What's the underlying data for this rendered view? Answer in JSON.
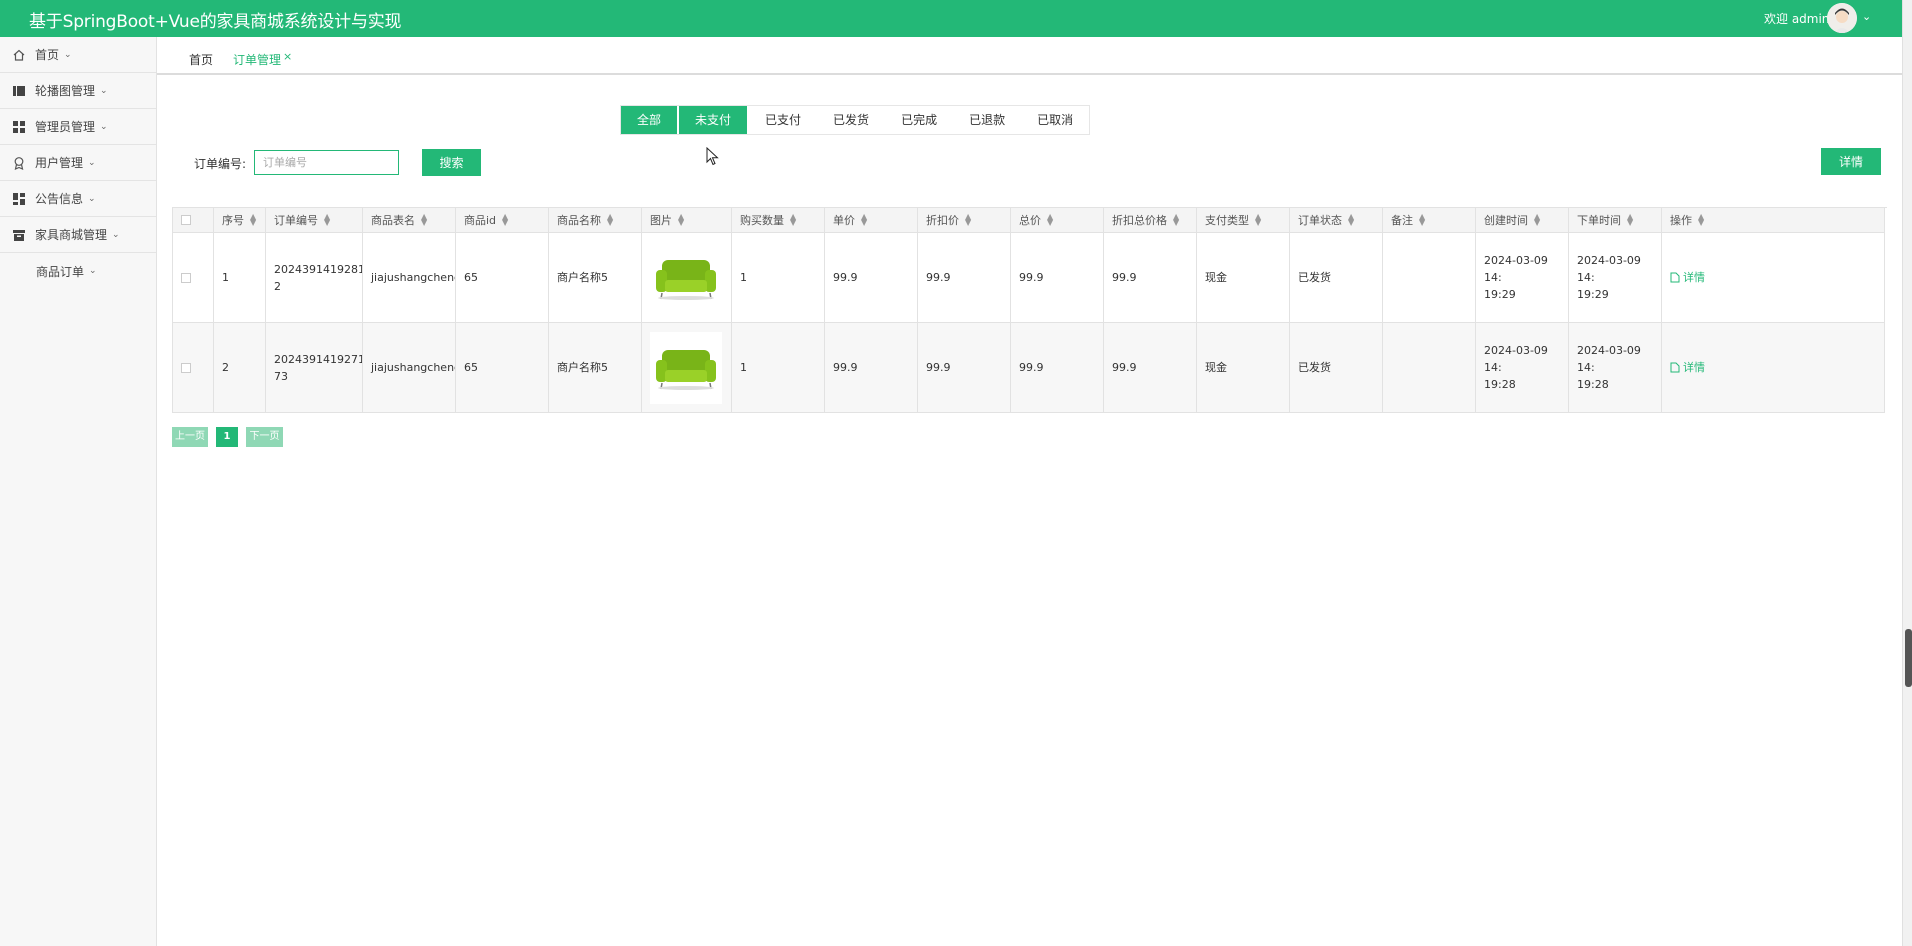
{
  "app": {
    "title": "基于SpringBoot+Vue的家具商城系统设计与实现",
    "welcome": "欢迎 admin",
    "accent": "#23b877"
  },
  "sidebar": {
    "items": [
      {
        "label": "首页",
        "icon": "home-icon"
      },
      {
        "label": "轮播图管理",
        "icon": "slides-icon"
      },
      {
        "label": "管理员管理",
        "icon": "grid-icon"
      },
      {
        "label": "用户管理",
        "icon": "user-badge-icon"
      },
      {
        "label": "公告信息",
        "icon": "dashboard-icon"
      },
      {
        "label": "家具商城管理",
        "icon": "box-icon"
      },
      {
        "label": "商品订单",
        "icon": ""
      }
    ]
  },
  "tabs": [
    {
      "label": "首页"
    },
    {
      "label": "订单管理",
      "close": "×"
    }
  ],
  "filters": [
    "全部",
    "未支付",
    "已支付",
    "已发货",
    "已完成",
    "已退款",
    "已取消"
  ],
  "search": {
    "label": "订单编号:",
    "placeholder": "订单编号",
    "button": "搜索"
  },
  "detail_button": "详情",
  "table": {
    "columns": [
      "序号",
      "订单编号",
      "商品表名",
      "商品id",
      "商品名称",
      "图片",
      "购买数量",
      "单价",
      "折扣价",
      "总价",
      "折扣总价格",
      "支付类型",
      "订单状态",
      "备注",
      "创建时间",
      "下单时间",
      "操作"
    ],
    "rows": [
      {
        "index": "1",
        "order_no_1": "2024391419281",
        "order_no_2": "2",
        "table_name": "jiajushangcheng",
        "goods_id": "65",
        "goods_name": "商户名称5",
        "qty": "1",
        "price": "99.9",
        "discount_price": "99.9",
        "total": "99.9",
        "discount_total": "99.9",
        "pay_type": "现金",
        "status": "已发货",
        "remark": "",
        "created_1": "2024-03-09 14:",
        "created_2": "19:29",
        "ordered_1": "2024-03-09 14:",
        "ordered_2": "19:29",
        "action": "详情"
      },
      {
        "index": "2",
        "order_no_1": "2024391419271",
        "order_no_2": "73",
        "table_name": "jiajushangcheng",
        "goods_id": "65",
        "goods_name": "商户名称5",
        "qty": "1",
        "price": "99.9",
        "discount_price": "99.9",
        "total": "99.9",
        "discount_total": "99.9",
        "pay_type": "现金",
        "status": "已发货",
        "remark": "",
        "created_1": "2024-03-09 14:",
        "created_2": "19:28",
        "ordered_1": "2024-03-09 14:",
        "ordered_2": "19:28",
        "action": "详情"
      }
    ]
  },
  "pagination": {
    "prev": "上一页",
    "current": "1",
    "next": "下一页"
  }
}
